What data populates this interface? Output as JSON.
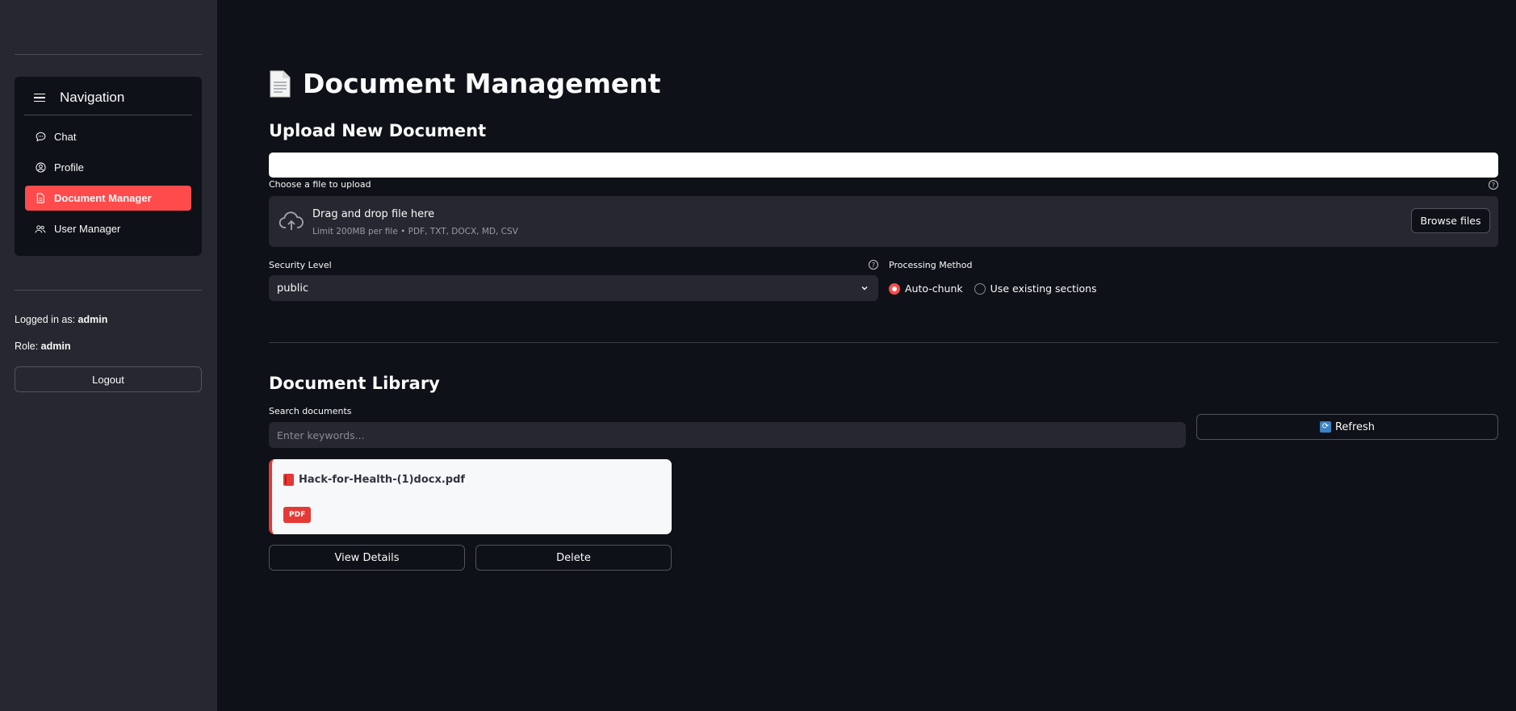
{
  "sidebar": {
    "nav_title": "Navigation",
    "items": [
      {
        "label": "Chat",
        "icon": "chat-bubble-icon",
        "active": false
      },
      {
        "label": "Profile",
        "icon": "user-circle-icon",
        "active": false
      },
      {
        "label": "Document Manager",
        "icon": "document-icon",
        "active": true
      },
      {
        "label": "User Manager",
        "icon": "users-icon",
        "active": false
      }
    ],
    "logged_in_prefix": "Logged in as:",
    "logged_in_user": "admin",
    "role_prefix": "Role:",
    "role_value": "admin",
    "logout_label": "Logout"
  },
  "page": {
    "title": "Document Management",
    "title_icon": "document-emoji-icon"
  },
  "upload": {
    "heading": "Upload New Document",
    "file_label": "Choose a file to upload",
    "drop_title": "Drag and drop file here",
    "drop_limit": "Limit 200MB per file • PDF, TXT, DOCX, MD, CSV",
    "browse_label": "Browse files",
    "security_label": "Security Level",
    "security_value": "public",
    "processing_label": "Processing Method",
    "processing_options": [
      {
        "label": "Auto-chunk",
        "selected": true
      },
      {
        "label": "Use existing sections",
        "selected": false
      }
    ]
  },
  "library": {
    "heading": "Document Library",
    "search_label": "Search documents",
    "search_placeholder": "Enter keywords...",
    "refresh_label": "Refresh",
    "documents": [
      {
        "name": "Hack-for-Health-(1)docx.pdf",
        "type_badge": "PDF",
        "view_label": "View Details",
        "delete_label": "Delete"
      }
    ]
  },
  "colors": {
    "accent": "#ff4b4b",
    "background": "#0e1117",
    "sidebar": "#262730",
    "pdf_red": "#e53935"
  }
}
